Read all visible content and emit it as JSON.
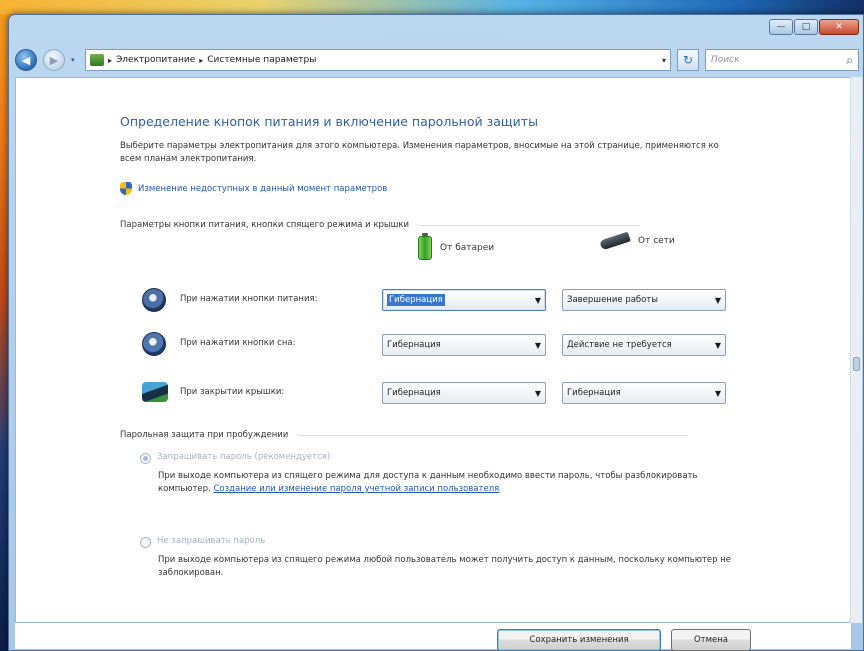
{
  "window": {
    "minimize": "—",
    "maximize": "□",
    "close": "✕"
  },
  "nav": {
    "crumbs": [
      "Электропитание",
      "Системные параметры"
    ],
    "crumb_sep": "▸",
    "search_placeholder": "Поиск",
    "back_glyph": "◀",
    "forward_glyph": "▶",
    "refresh_glyph": "↻",
    "dropdown_glyph": "▾",
    "search_glyph": "⌕"
  },
  "page": {
    "title": "Определение кнопок питания и включение парольной защиты",
    "description": "Выберите параметры электропитания для этого компьютера. Изменения параметров, вносимые на этой странице, применяются ко всем планам электропитания.",
    "uac_link": "Изменение недоступных в данный момент параметров"
  },
  "buttons_group": {
    "label": "Параметры кнопки питания, кнопки спящего режима и крышки",
    "col_battery": "От батареи",
    "col_ac": "От сети",
    "rows": [
      {
        "label": "При нажатии кнопки питания:",
        "battery": "Гибернация",
        "ac": "Завершение работы"
      },
      {
        "label": "При нажатии кнопки сна:",
        "battery": "Гибернация",
        "ac": "Действие не требуется"
      },
      {
        "label": "При закрытии крышки:",
        "battery": "Гибернация",
        "ac": "Гибернация"
      }
    ]
  },
  "password_group": {
    "label": "Парольная защита при пробуждении",
    "option1": {
      "label": "Запрашивать пароль (рекомендуется)",
      "desc": "При выходе компьютера из спящего режима для доступа к данным необходимо ввести пароль, чтобы разблокировать компьютер.",
      "link": "Создание или изменение пароля учетной записи пользователя"
    },
    "option2": {
      "label": "Не запрашивать пароль",
      "desc": "При выходе компьютера из спящего режима любой пользователь может получить доступ к данным, поскольку компьютер не заблокирован."
    }
  },
  "footer": {
    "save": "Сохранить изменения",
    "cancel": "Отмена"
  }
}
